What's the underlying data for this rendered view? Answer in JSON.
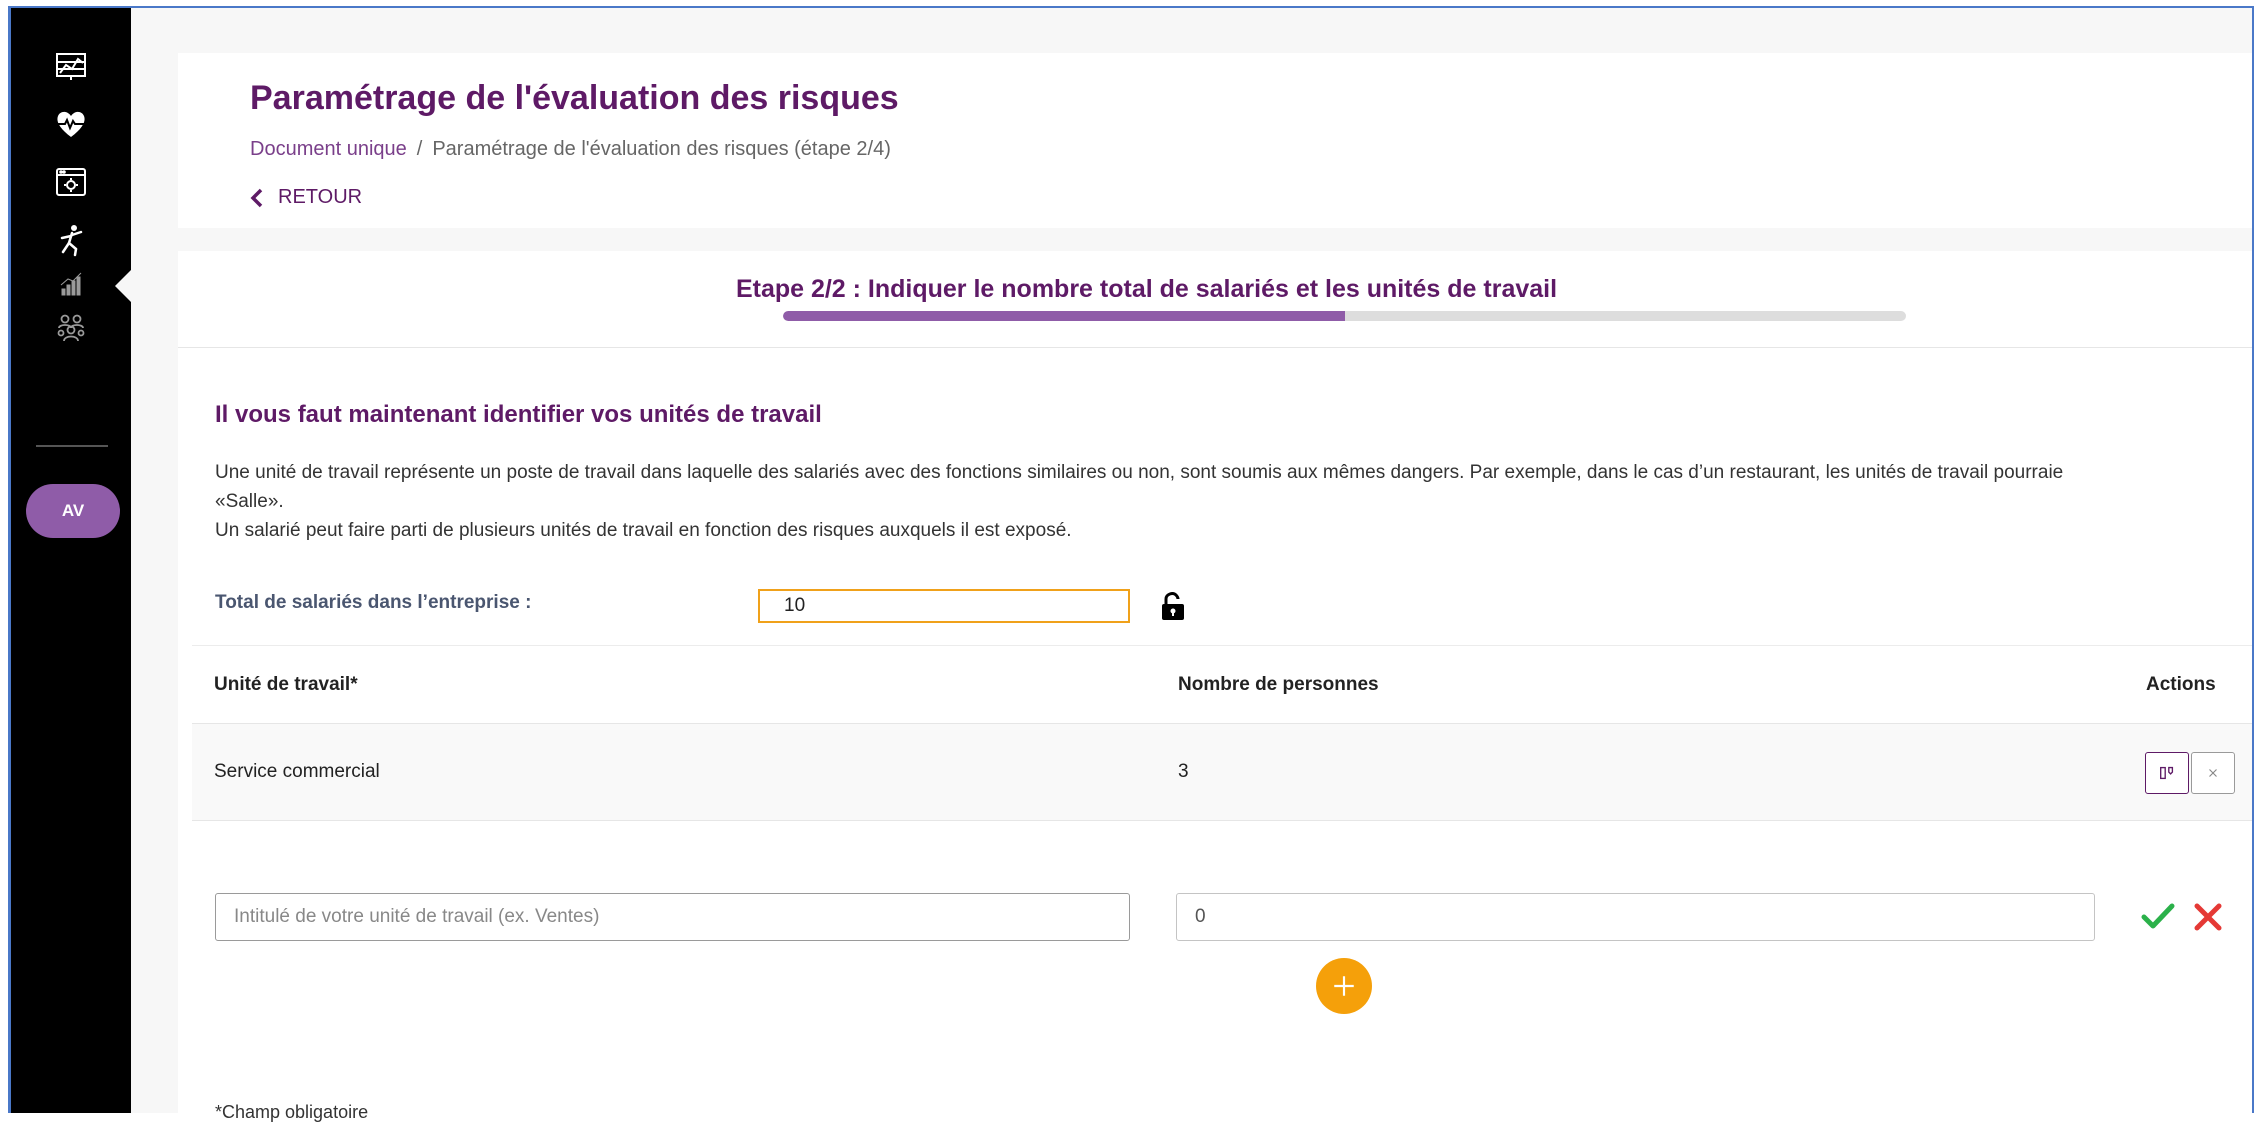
{
  "sidebar": {
    "icons": [
      "dashboard-chart-icon",
      "heart-health-icon",
      "browser-settings-icon",
      "figure-hazard-icon",
      "bar-chart-icon",
      "team-icon"
    ],
    "avatar_initials": "AV"
  },
  "header": {
    "title": "Paramétrage de l'évaluation des risques",
    "breadcrumb": {
      "parent": "Document unique",
      "separator": "/",
      "current": "Paramétrage de l'évaluation des risques (étape 2/4)"
    },
    "back_label": "RETOUR"
  },
  "step": {
    "title": "Etape 2/2 : Indiquer le nombre total de salariés et les unités de travail",
    "progress_fraction": 0.5
  },
  "section": {
    "title": "Il vous faut maintenant identifier vos unités de travail",
    "description_line1": "Une unité de travail représente un poste de travail dans laquelle des salariés avec des fonctions similaires ou non, sont soumis aux mêmes dangers. Par exemple, dans le cas d’un restaurant, les unités de travail pourraie",
    "description_line2": "«Salle».",
    "description_line3": "Un salarié peut faire parti de plusieurs unités de travail en fonction des risques auxquels il est exposé."
  },
  "total": {
    "label": "Total de salariés dans l’entreprise :",
    "value": "10"
  },
  "table": {
    "headers": {
      "unit": "Unité de travail*",
      "count": "Nombre de personnes",
      "actions": "Actions"
    },
    "rows": [
      {
        "unit": "Service commercial",
        "count": "3"
      }
    ]
  },
  "new_row": {
    "name_placeholder": "Intitulé de votre unité de travail (ex. Ventes)",
    "count_value": "0"
  },
  "required_note": "*Champ obligatoire",
  "colors": {
    "brand_purple": "#5e1a66",
    "accent_purple": "#8f5ca8",
    "orange": "#f5a00a",
    "confirm_green": "#2bb14a",
    "cancel_red": "#e53935"
  }
}
